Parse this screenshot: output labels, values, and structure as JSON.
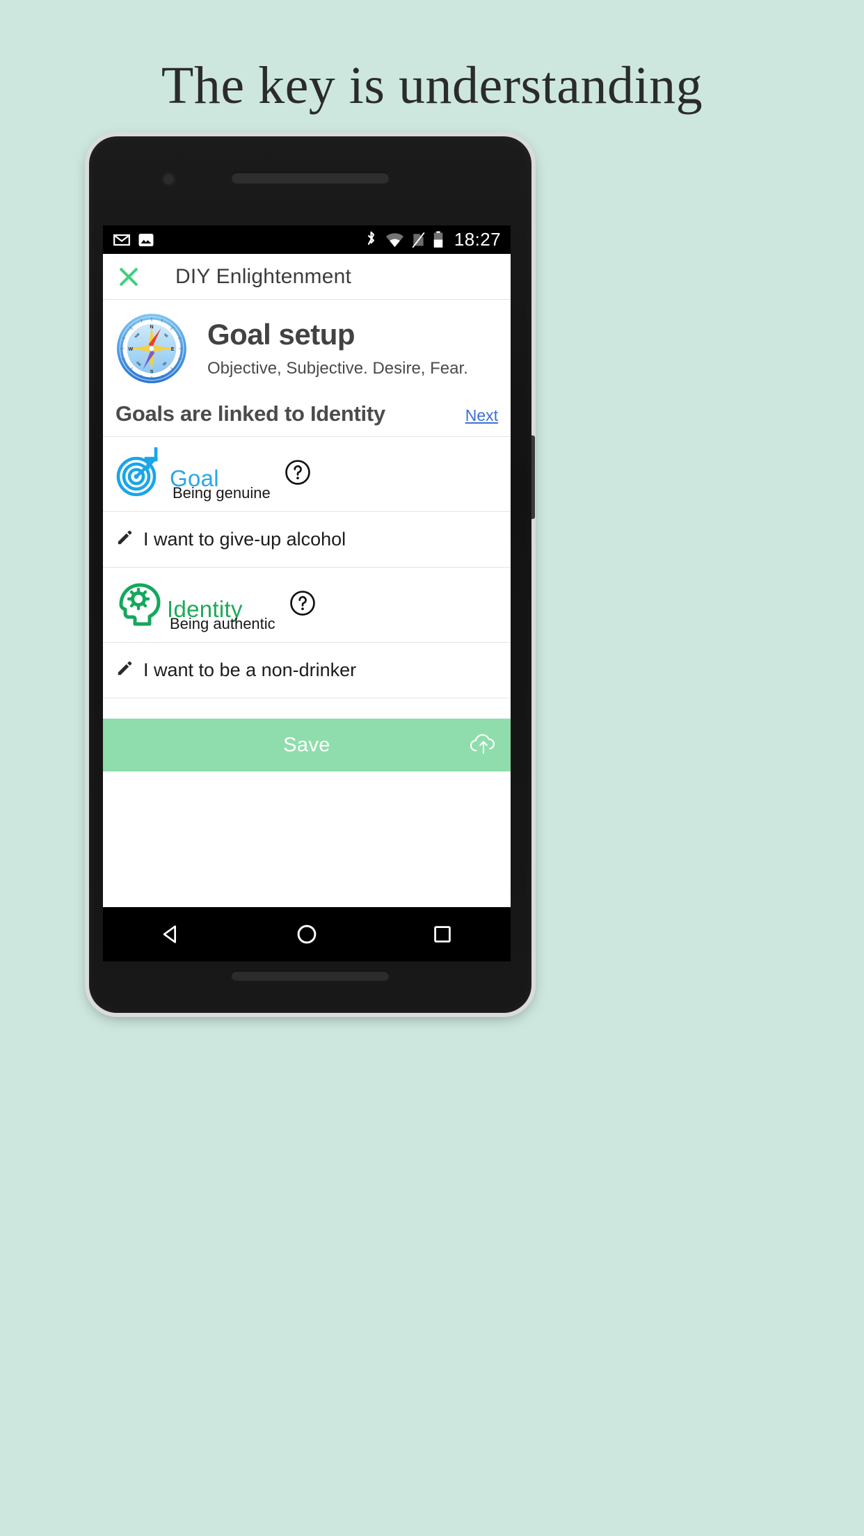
{
  "headline": "The key is understanding",
  "colors": {
    "page_background": "#cde7de",
    "accent_green": "#3ed17c",
    "save_bar": "#8fddac",
    "goal_blue": "#29a7e8",
    "identity_green": "#1faa58",
    "link_blue": "#3d6fd4"
  },
  "statusbar": {
    "left_icons": [
      "gmail-icon",
      "photos-icon"
    ],
    "right_icons": [
      "bluetooth-icon",
      "wifi-icon",
      "no-sim-icon",
      "battery-icon"
    ],
    "time": "18:27"
  },
  "appbar": {
    "close_icon": "close-icon",
    "title": "DIY Enlightenment"
  },
  "hero": {
    "icon": "compass-icon",
    "title": "Goal setup",
    "subtitle": "Objective, Subjective. Desire, Fear."
  },
  "section": {
    "title": "Goals are linked to Identity",
    "next_label": "Next"
  },
  "rows": [
    {
      "type": "label",
      "icon": "target-icon",
      "main": "Goal",
      "sub": "Being genuine",
      "help": "help-icon"
    },
    {
      "type": "input",
      "icon": "pencil-icon",
      "value": "I want to give-up alcohol"
    },
    {
      "type": "label",
      "icon": "head-gear-icon",
      "main": "Identity",
      "sub": "Being authentic",
      "help": "help-icon"
    },
    {
      "type": "input",
      "icon": "pencil-icon",
      "value": "I want to be a non-drinker"
    }
  ],
  "save": {
    "label": "Save",
    "icon": "cloud-upload-icon"
  },
  "navbar": {
    "back": "back-triangle-icon",
    "home": "home-circle-icon",
    "recents": "recents-square-icon"
  }
}
